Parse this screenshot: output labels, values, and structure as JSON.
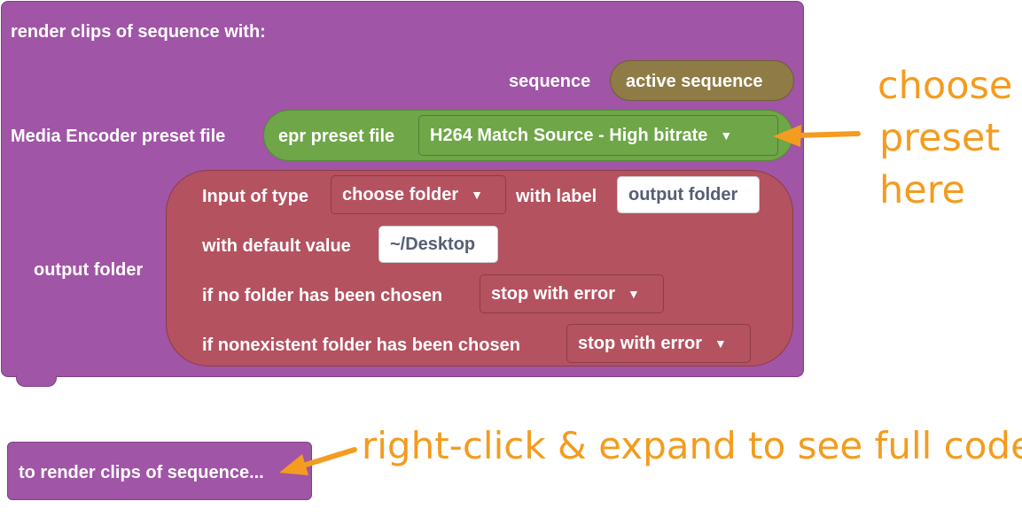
{
  "main_block": {
    "title": "render clips of sequence  with:",
    "sequence_label": "sequence",
    "sequence_value": "active sequence",
    "preset_label": "Media Encoder preset file",
    "preset_block_label": "epr preset file",
    "preset_value": "H264 Match Source - High bitrate",
    "output_label": "output folder",
    "input_type_label": "Input of type",
    "input_type_value": "choose folder",
    "with_label": "with label",
    "label_value": "output folder",
    "default_label": "with default value",
    "default_value": "~/Desktop",
    "no_folder_label": "if no folder has been chosen",
    "no_folder_value": "stop with error",
    "nonexistent_label": "if nonexistent folder has been chosen",
    "nonexistent_value": "stop with error"
  },
  "call_block": {
    "label": "to render clips of sequence..."
  },
  "annotations": {
    "choose_line1": "choose",
    "choose_line2": "preset",
    "choose_line3": "here",
    "expand": "right-click & expand to see full code"
  },
  "dropdown_arrow": "▼",
  "colors": {
    "event_block": "#a055a6",
    "sequence_pill": "#8f7b46",
    "preset_pill": "#6ea648",
    "folder_block": "#b45260",
    "annotation": "#f39c1f"
  }
}
